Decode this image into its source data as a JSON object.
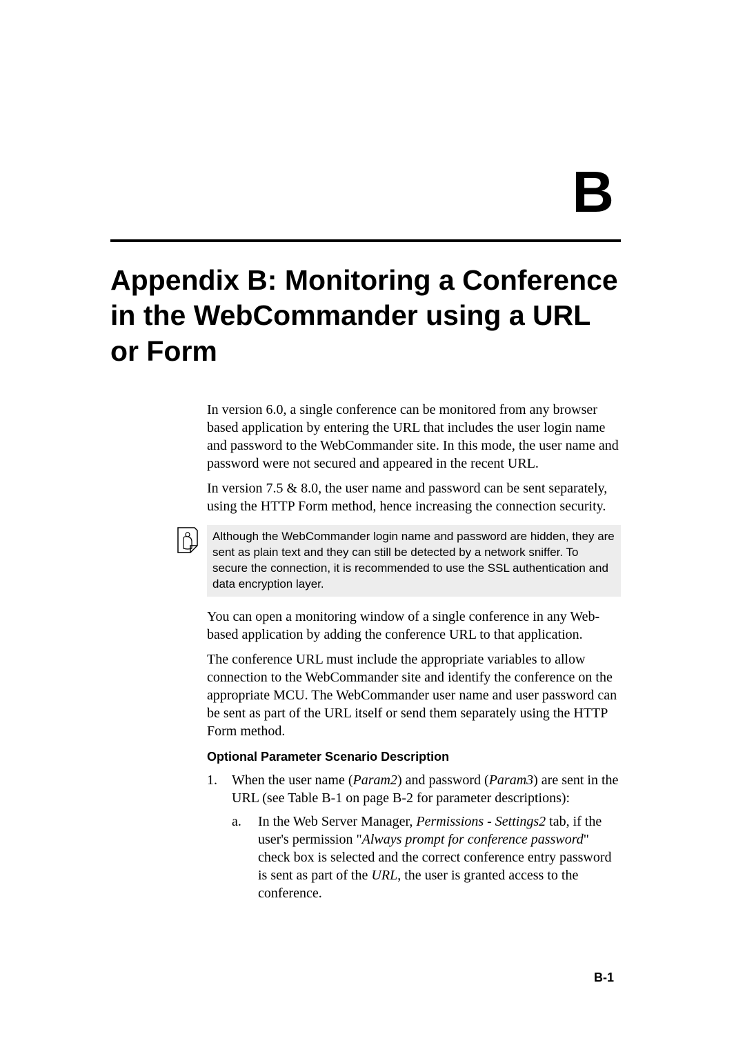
{
  "appendix_letter": "B",
  "appendix_title": "Appendix B: Monitoring a Conference in the WebCommander using a URL or Form",
  "paragraphs": {
    "p1": "In version 6.0, a single conference can be monitored from any browser based application by entering the URL that includes the user login name and password to the WebCommander site. In this mode, the user name and password were not secured and appeared in the recent URL.",
    "p2": "In version 7.5 & 8.0, the user name and password can be sent separately, using the HTTP Form method, hence increasing the connection security.",
    "note": "Although the WebCommander login name and password are hidden, they are sent as plain text and they can still be detected by a network sniffer. To secure the connection, it is recommended to use the SSL authentication and data encryption layer.",
    "p3": "You can open a monitoring window of a single conference in any Web-based application by adding the conference URL to that application.",
    "p4": "The conference URL must include the appropriate variables to allow connection to the WebCommander site and identify the conference on the appropriate MCU. The WebCommander user name and user password can be sent as part of the URL itself or send them separately using the HTTP Form method."
  },
  "heading_optional": "Optional Parameter Scenario Description",
  "list": {
    "num1": "1.",
    "item1_pre": "When the user name (",
    "item1_param2": "Param2",
    "item1_mid": ") and password (",
    "item1_param3": "Param3",
    "item1_post": ") are sent in the URL (see Table B-1 on page B-2 for parameter descriptions):",
    "sub_a": "a.",
    "sub_a_pre": "In the Web Server Manager, ",
    "sub_a_perm": "Permissions - Settings2",
    "sub_a_mid1": " tab, if the user's permission \"",
    "sub_a_prompt": "Always prompt for conference password",
    "sub_a_mid2": "\" check box is selected and the correct conference entry password is sent as part of the ",
    "sub_a_url": "URL",
    "sub_a_post": ", the user is granted access to the conference."
  },
  "page_number": "B-1"
}
